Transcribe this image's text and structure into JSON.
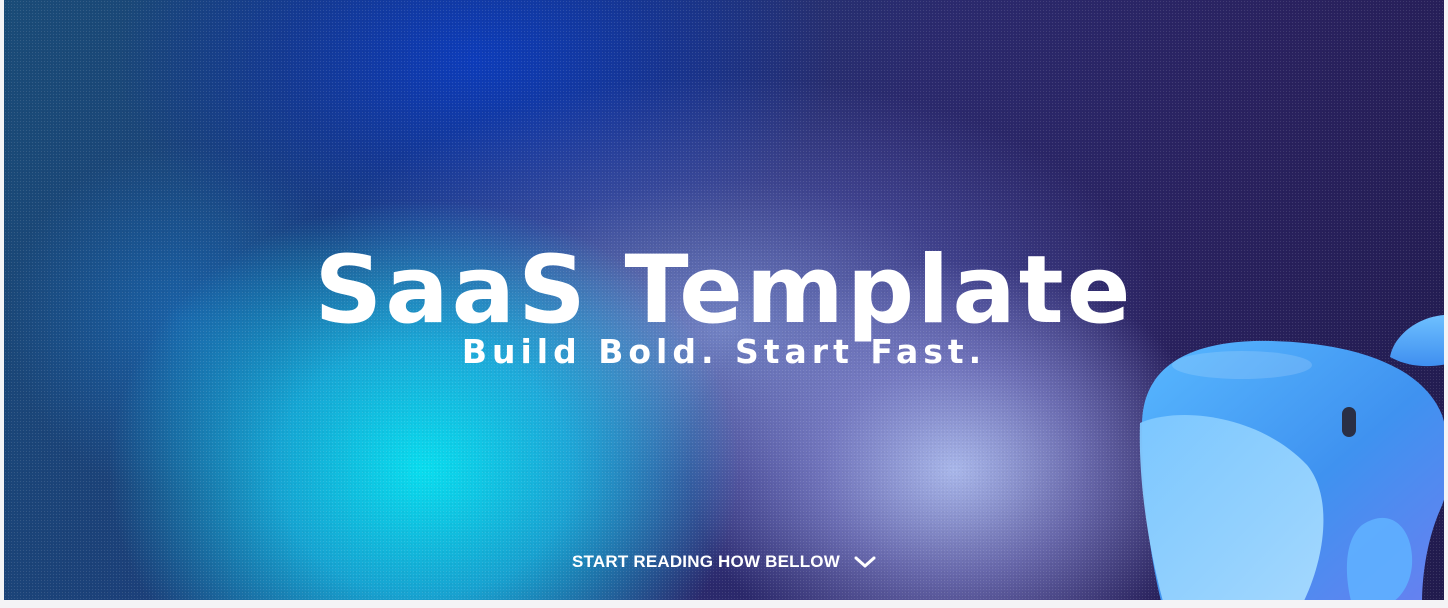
{
  "hero": {
    "title": "SaaS Template",
    "subtitle": "Build Bold. Start Fast."
  },
  "cta": {
    "label": "START READING HOW BELLOW",
    "icon": "chevron-down-icon"
  },
  "mascot": {
    "icon": "whale-mascot"
  },
  "colors": {
    "text": "#ffffff",
    "cyan": "#08e6f5",
    "deep_blue": "#0c3cbe",
    "violet": "#2a2260",
    "lavender": "#afbef0",
    "whale_blue": "#4aa8f5"
  }
}
